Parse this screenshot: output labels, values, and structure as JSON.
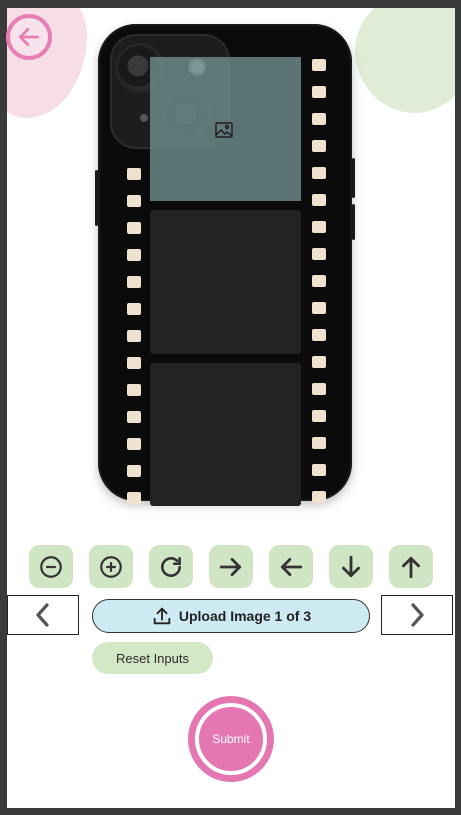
{
  "upload": {
    "label": "Upload Image 1 of 3"
  },
  "reset": {
    "label": "Reset Inputs"
  },
  "submit": {
    "label": "Submit"
  },
  "controls": [
    {
      "icon": "zoom-out-icon"
    },
    {
      "icon": "zoom-in-icon"
    },
    {
      "icon": "rotate-icon"
    },
    {
      "icon": "move-right-icon"
    },
    {
      "icon": "move-left-icon"
    },
    {
      "icon": "move-down-icon"
    },
    {
      "icon": "move-up-icon"
    }
  ],
  "colors": {
    "accent_pink": "#e477b1",
    "control_green": "#cfe5c4",
    "upload_blue": "#cde9f1",
    "photo_selected": "#6c8787",
    "perforation": "#efe3d0"
  },
  "film_frames": 3,
  "selected_frame": 1
}
